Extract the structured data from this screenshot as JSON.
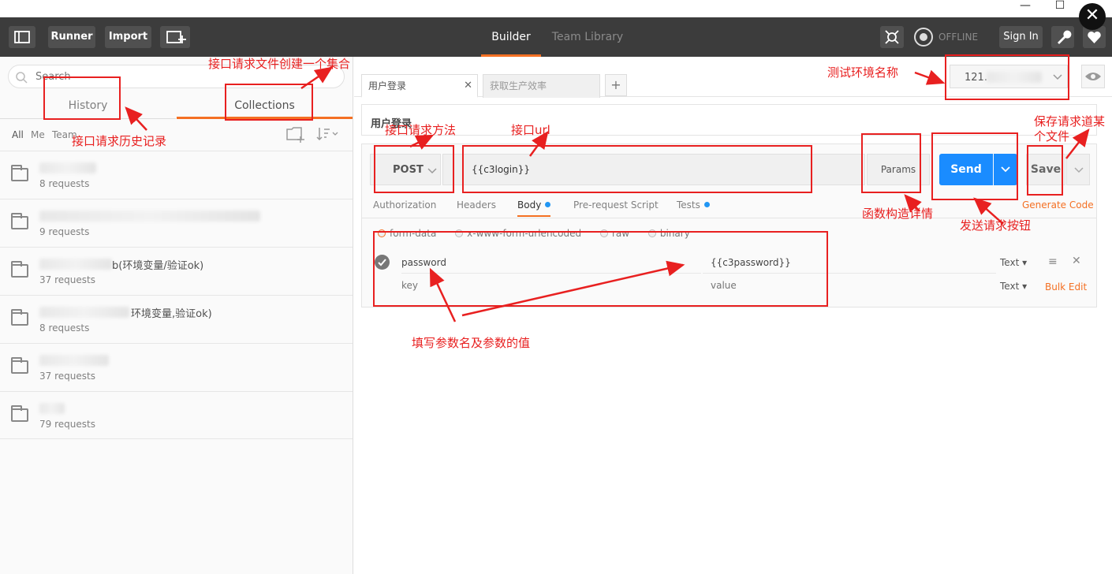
{
  "window": {
    "minimize": "—",
    "maximize": "☐",
    "close": "✕"
  },
  "topbar": {
    "runner": "Runner",
    "import": "Import",
    "tabs": [
      {
        "label": "Builder"
      },
      {
        "label": "Team Library"
      }
    ],
    "status": "OFFLINE",
    "sign_in": "Sign In"
  },
  "sidebar": {
    "search_placeholder": "Search",
    "tabs": [
      {
        "label": "History"
      },
      {
        "label": "Collections"
      }
    ],
    "filters": [
      "All",
      "Me",
      "Team"
    ],
    "collections": [
      {
        "name": "",
        "requests": "8 requests"
      },
      {
        "name": "",
        "requests": "9 requests"
      },
      {
        "name": "b(环境变量/验证ok)",
        "requests": "37 requests"
      },
      {
        "name": "环境变量,验证ok)",
        "requests": "8 requests"
      },
      {
        "name": "",
        "requests": "37 requests"
      },
      {
        "name": "",
        "requests": "79 requests"
      }
    ]
  },
  "request_tabs": [
    {
      "label": "用户登录"
    },
    {
      "label": "获取生产效率"
    }
  ],
  "add_tab": "+",
  "environment": {
    "selected": "121."
  },
  "request": {
    "name": "用户登录",
    "method": "POST",
    "url": "{{c3login}}",
    "params": "Params",
    "send": "Send",
    "save": "Save",
    "generate_code": "Generate Code",
    "subtabs": [
      {
        "label": "Authorization"
      },
      {
        "label": "Headers"
      },
      {
        "label": "Body"
      },
      {
        "label": "Pre-request Script"
      },
      {
        "label": "Tests"
      }
    ],
    "body_modes": [
      "form-data",
      "x-www-form-urlencoded",
      "raw",
      "binary"
    ],
    "rows": [
      {
        "key": "password",
        "value": "{{c3password}}",
        "type": "Text"
      },
      {
        "key_placeholder": "key",
        "value_placeholder": "value",
        "type": "Text"
      }
    ],
    "bulk_edit": "Bulk Edit"
  },
  "annotations": {
    "collection": "接口请求文件创建一个集合",
    "history": "接口请求历史记录",
    "env": "测试环境名称",
    "method": "接口请求方法",
    "url": "接口url",
    "params": "函数构造详情",
    "send": "发送请求按钮",
    "save1": "保存请求道某",
    "save2": "个文件",
    "body": "填写参数名及参数的值"
  },
  "colors": {
    "accent": "#f47023",
    "send": "#1a8cff",
    "annotation": "#e82020",
    "topbar": "#3c3c3c"
  }
}
